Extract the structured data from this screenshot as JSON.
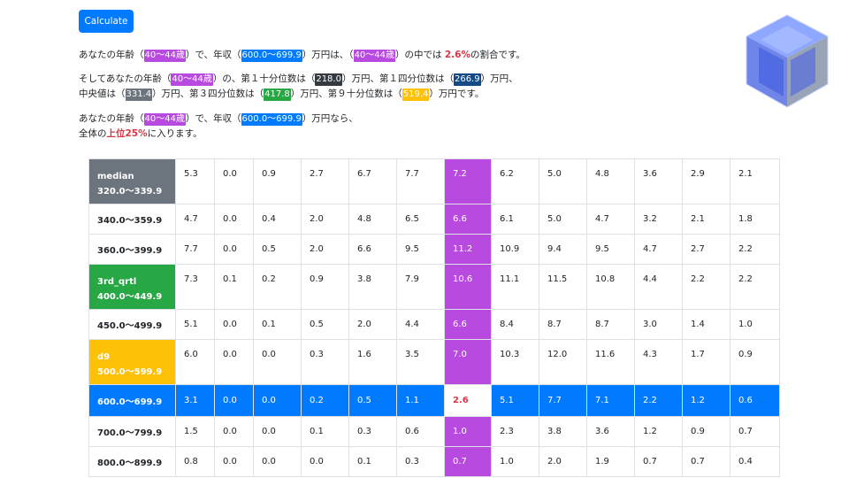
{
  "button": {
    "label": "Calculate"
  },
  "sentence1": {
    "t1": "あなたの年齢（",
    "age": "40〜44歳",
    "t2": "）で、年収（",
    "income": "600.0〜699.9",
    "t3": "）万円は、（",
    "age2": "40〜44歳",
    "t4": "）の中では ",
    "pct": "2.6%",
    "t5": "の割合です。"
  },
  "sentence2": {
    "t1": "そしてあなたの年齢（",
    "age": "40〜44歳",
    "t2": "）の、第１十分位数は（",
    "d1": "218.0",
    "t3": "）万円、第１四分位数は（",
    "q1": "266.9",
    "t4": "）万円、",
    "t5": "中央値は（",
    "median": "331.4",
    "t6": "）万円、第３四分位数は（",
    "q3": "417.8",
    "t7": "）万円、第９十分位数は（",
    "d9": "519.4",
    "t8": "）万円です。"
  },
  "sentence3": {
    "t1": "あなたの年齢（",
    "age": "40〜44歳",
    "t2": "）で、年収（",
    "income": "600.0〜699.9",
    "t3": "）万円なら、",
    "t4": "全体の",
    "rank": "上位25%",
    "t5": "に入ります。"
  },
  "colors": {
    "purple": "#b94ae0",
    "blue": "#007bff",
    "gray": "#6c757d",
    "green": "#28a745",
    "yellow": "#ffc107",
    "red": "#dc3545"
  },
  "table": {
    "rows": [
      {
        "tag": "median",
        "range": "320.0〜339.9",
        "values": [
          "5.3",
          "0.0",
          "0.9",
          "2.7",
          "6.7",
          "7.7",
          "7.2",
          "6.2",
          "5.0",
          "4.8",
          "3.6",
          "2.9",
          "2.1"
        ]
      },
      {
        "tag": "",
        "range": "340.0〜359.9",
        "values": [
          "4.7",
          "0.0",
          "0.4",
          "2.0",
          "4.8",
          "6.5",
          "6.6",
          "6.1",
          "5.0",
          "4.7",
          "3.2",
          "2.1",
          "1.8"
        ]
      },
      {
        "tag": "",
        "range": "360.0〜399.9",
        "values": [
          "7.7",
          "0.0",
          "0.5",
          "2.0",
          "6.6",
          "9.5",
          "11.2",
          "10.9",
          "9.4",
          "9.5",
          "4.7",
          "2.7",
          "2.2"
        ]
      },
      {
        "tag": "3rd_qrtl",
        "range": "400.0〜449.9",
        "values": [
          "7.3",
          "0.1",
          "0.2",
          "0.9",
          "3.8",
          "7.9",
          "10.6",
          "11.1",
          "11.5",
          "10.8",
          "4.4",
          "2.2",
          "2.2"
        ]
      },
      {
        "tag": "",
        "range": "450.0〜499.9",
        "values": [
          "5.1",
          "0.0",
          "0.1",
          "0.5",
          "2.0",
          "4.4",
          "6.6",
          "8.4",
          "8.7",
          "8.7",
          "3.0",
          "1.4",
          "1.0"
        ]
      },
      {
        "tag": "d9",
        "range": "500.0〜599.9",
        "values": [
          "6.0",
          "0.0",
          "0.0",
          "0.3",
          "1.6",
          "3.5",
          "7.0",
          "10.3",
          "12.0",
          "11.6",
          "4.3",
          "1.7",
          "0.9"
        ]
      },
      {
        "tag": "",
        "range": "600.0〜699.9",
        "values": [
          "3.1",
          "0.0",
          "0.0",
          "0.2",
          "0.5",
          "1.1",
          "2.6",
          "5.1",
          "7.7",
          "7.1",
          "2.2",
          "1.2",
          "0.6"
        ]
      },
      {
        "tag": "",
        "range": "700.0〜799.9",
        "values": [
          "1.5",
          "0.0",
          "0.0",
          "0.1",
          "0.3",
          "0.6",
          "1.0",
          "2.3",
          "3.8",
          "3.6",
          "1.2",
          "0.9",
          "0.7"
        ]
      },
      {
        "tag": "",
        "range": "800.0〜899.9",
        "values": [
          "0.8",
          "0.0",
          "0.0",
          "0.0",
          "0.1",
          "0.3",
          "0.7",
          "1.0",
          "2.0",
          "1.9",
          "0.7",
          "0.7",
          "0.4"
        ]
      }
    ]
  }
}
